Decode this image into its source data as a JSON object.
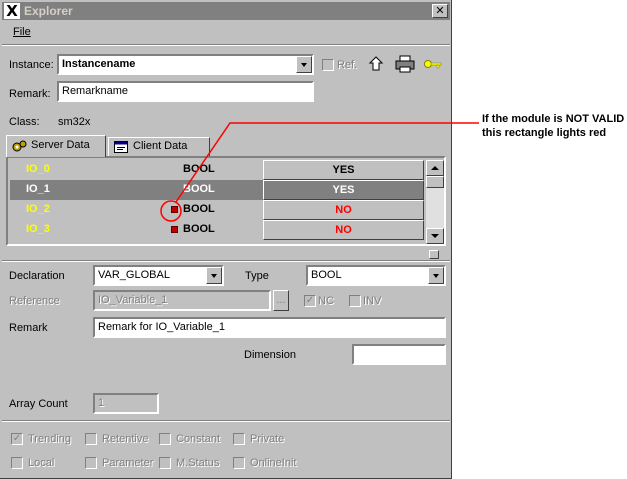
{
  "window": {
    "title": "Explorer",
    "close_glyph": "✕",
    "logo_glyph": "X"
  },
  "menu": {
    "file": "File"
  },
  "instance": {
    "label": "Instance:",
    "value": "Instancename",
    "ref_label": "Ref."
  },
  "remark_top": {
    "label": "Remark:",
    "value": "Remarkname"
  },
  "class": {
    "label": "Class:",
    "value": "sm32x"
  },
  "tabs": [
    {
      "label": "Server Data",
      "icon": "gears-icon"
    },
    {
      "label": "Client Data",
      "icon": "client-data-icon"
    }
  ],
  "grid": {
    "rows": [
      {
        "name": "IO_0",
        "type": "BOOL",
        "value": "YES",
        "selected": false,
        "invalid": false
      },
      {
        "name": "IO_1",
        "type": "BOOL",
        "value": "YES",
        "selected": true,
        "invalid": false
      },
      {
        "name": "IO_2",
        "type": "BOOL",
        "value": "NO",
        "selected": false,
        "invalid": true
      },
      {
        "name": "IO_3",
        "type": "BOOL",
        "value": "NO",
        "selected": false,
        "invalid": true
      }
    ]
  },
  "declaration": {
    "label": "Declaration",
    "value": "VAR_GLOBAL",
    "type_label": "Type",
    "type_value": "BOOL"
  },
  "reference": {
    "label": "Reference",
    "value": "IO_Variable_1",
    "browse": "...",
    "nc_label": "NC",
    "inv_label": "INV"
  },
  "remark_var": {
    "label": "Remark",
    "value": "Remark for IO_Variable_1"
  },
  "dimension": {
    "label": "Dimension",
    "value": ""
  },
  "array_count": {
    "label": "Array Count",
    "value": "1"
  },
  "flags": {
    "row1": [
      {
        "label": "Trending",
        "checked": true
      },
      {
        "label": "Retentive",
        "checked": false
      },
      {
        "label": "Constant",
        "checked": false
      },
      {
        "label": "Private",
        "checked": false
      }
    ],
    "row2": [
      {
        "label": "Local",
        "checked": false
      },
      {
        "label": "Parameter",
        "checked": false
      },
      {
        "label": "M.Status",
        "checked": false
      },
      {
        "label": "OnlineInit",
        "checked": false
      }
    ]
  },
  "callout": {
    "line1": "If the module is NOT VALID",
    "line2": "this rectangle lights red"
  },
  "colors": {
    "selected_row": "#808080",
    "io_label_yellow": "#ffff00",
    "value_no_red": "#ff0000",
    "status_square_red": "#c00000",
    "callout_line": "#ff0000"
  }
}
